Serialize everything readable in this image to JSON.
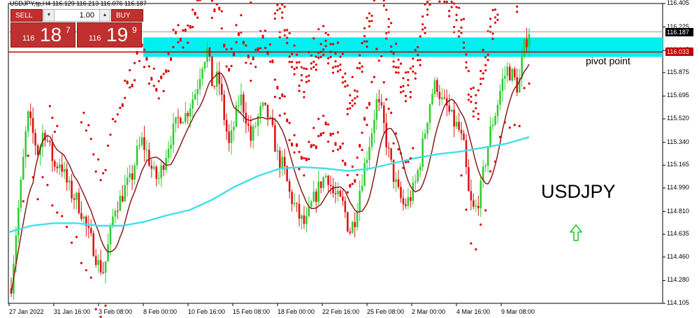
{
  "window_title": "USDJPY,tp,H4  116.129 116.213 116.076 116.187",
  "trade_panel": {
    "sell_label": "SELL",
    "buy_label": "BUY",
    "lot": "1.00",
    "bid_prefix": "116",
    "bid_big": "18",
    "bid_sup": "7",
    "ask_prefix": "116",
    "ask_big": "19",
    "ask_sup": "9"
  },
  "annotations": {
    "pivot_label": "pivot point",
    "symbol_label": "USDJPY"
  },
  "colors": {
    "bull": "#32cd32",
    "bear": "#e01414",
    "zone": "#00f0f0",
    "ma_slow": "#3fe0e8",
    "ma_fast": "#8b1a1a",
    "sar": "#dd0000",
    "pivot_line": "#c00000",
    "arrow": "#22c922"
  },
  "chart_data": {
    "type": "candlestick",
    "y_ticks": [
      "116.405",
      "116.225",
      "116.045",
      "115.875",
      "115.695",
      "115.520",
      "115.340",
      "115.165",
      "114.990",
      "114.810",
      "114.635",
      "114.460",
      "114.280",
      "114.105"
    ],
    "x_ticks": [
      "27 Jan 2022",
      "31 Jan 16:00",
      "3 Feb 08:00",
      "8 Feb 00:00",
      "10 Feb 16:00",
      "15 Feb 08:00",
      "18 Feb 00:00",
      "22 Feb 16:00",
      "25 Feb 08:00",
      "2 Mar 00:00",
      "4 Mar 16:00",
      "9 Mar 08:00"
    ],
    "current_price": "116.187",
    "pivot_price": "116.033",
    "ylim": [
      114.105,
      116.405
    ],
    "zone": [
      115.995,
      116.145
    ],
    "close_path": [
      114.25,
      114.7,
      115.1,
      115.55,
      115.4,
      115.25,
      115.45,
      115.3,
      115.15,
      115.2,
      115.05,
      114.95,
      114.9,
      114.8,
      114.65,
      114.55,
      114.4,
      114.35,
      114.6,
      114.85,
      114.9,
      115.0,
      115.05,
      115.25,
      115.35,
      115.25,
      115.1,
      115.05,
      115.2,
      115.35,
      115.45,
      115.55,
      115.55,
      115.65,
      115.75,
      115.95,
      116.05,
      115.75,
      115.85,
      115.55,
      115.3,
      115.5,
      115.7,
      115.55,
      115.35,
      115.5,
      115.6,
      115.55,
      115.4,
      115.2,
      115.15,
      114.95,
      114.85,
      114.75,
      114.7,
      114.85,
      114.95,
      115.05,
      115.1,
      114.95,
      114.9,
      114.85,
      114.65,
      114.75,
      115.0,
      115.2,
      115.4,
      115.65,
      115.55,
      115.3,
      115.1,
      114.95,
      114.85,
      114.9,
      115.0,
      115.2,
      115.45,
      115.7,
      115.8,
      115.65,
      115.6,
      115.5,
      115.45,
      115.3,
      114.9,
      114.8,
      114.95,
      115.2,
      115.45,
      115.6,
      115.8,
      115.9,
      115.85,
      115.75,
      116.05,
      116.2
    ],
    "ma_slow": [
      114.65,
      114.7,
      114.72,
      114.72,
      114.7,
      114.7,
      114.73,
      114.78,
      114.82,
      114.9,
      115.0,
      115.08,
      115.14,
      115.15,
      115.14,
      115.12,
      115.14,
      115.18,
      115.22,
      115.25,
      115.27,
      115.3,
      115.33,
      115.38
    ],
    "sar_high_segments": [
      [
        [
          16,
          4
        ],
        [
          5,
          3
        ],
        [
          1,
          3
        ]
      ],
      [
        [
          29,
          120
        ],
        [
          20,
          170
        ],
        [
          20,
          210
        ],
        [
          12,
          255
        ],
        [
          10,
          295
        ],
        [
          12,
          340
        ],
        [
          12,
          380
        ],
        [
          12,
          410
        ]
      ],
      [
        [
          46,
          121
        ],
        [
          33,
          240
        ],
        [
          34,
          260
        ],
        [
          35,
          282
        ]
      ],
      [
        [
          69,
          230
        ],
        [
          25,
          250
        ],
        [
          30,
          270
        ],
        [
          28,
          286
        ],
        [
          28,
          300
        ]
      ],
      [
        [
          84,
          255
        ],
        [
          20,
          275
        ],
        [
          20,
          290
        ],
        [
          15,
          300
        ]
      ],
      [
        [
          99,
          210
        ],
        [
          25,
          245
        ],
        [
          25,
          275
        ],
        [
          35,
          300
        ]
      ]
    ]
  }
}
